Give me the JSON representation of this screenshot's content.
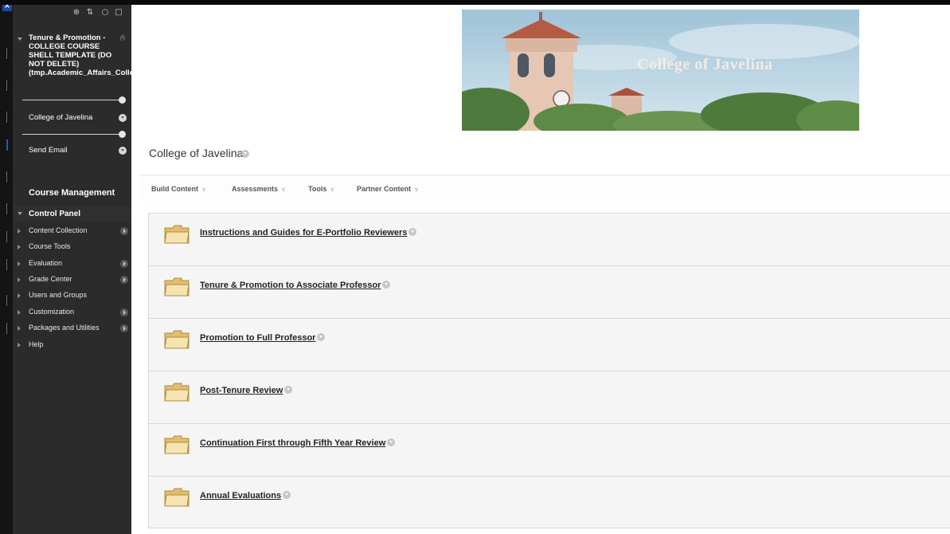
{
  "sidebar": {
    "course_title": "Tenure & Promotion - COLLEGE COURSE SHELL TEMPLATE (DO NOT DELETE) (tmp.Academic_Affairs_College_Shell)",
    "links": [
      "College of Javelina",
      "Send Email"
    ],
    "course_management_heading": "Course Management",
    "control_panel_label": "Control Panel",
    "control_panel_items": [
      "Content Collection",
      "Course Tools",
      "Evaluation",
      "Grade Center",
      "Users and Groups",
      "Customization",
      "Packages and Utilities",
      "Help"
    ]
  },
  "banner": {
    "title": "College of Javelina"
  },
  "main": {
    "page_title": "College of Javelina",
    "action_bar": [
      "Build Content",
      "Assessments",
      "Tools",
      "Partner Content"
    ],
    "content_items": [
      "Instructions and Guides for E-Portfolio Reviewers",
      "Tenure & Promotion to Associate Professor",
      "Promotion to Full Professor",
      "Post-Tenure Review",
      "Continuation First through Fifth Year Review",
      "Annual Evaluations"
    ]
  },
  "colors": {
    "sidebar_bg": "#2b2b2b",
    "content_bg": "#f5f5f5",
    "link_text": "#222222"
  }
}
